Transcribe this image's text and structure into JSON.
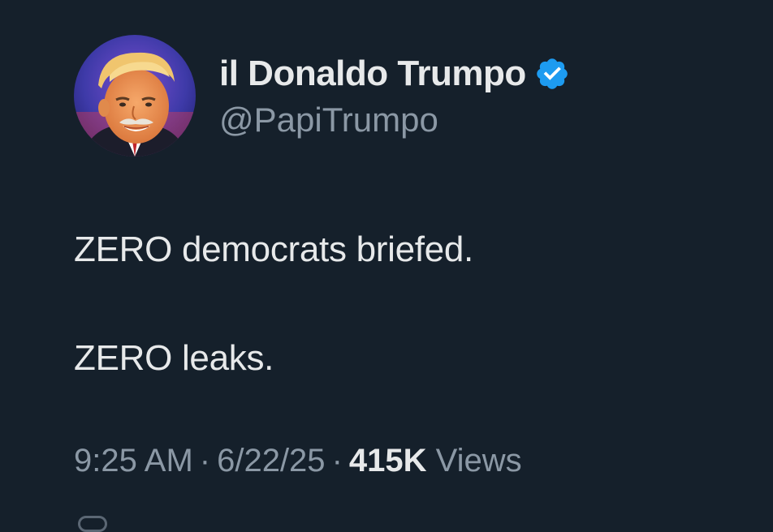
{
  "tweet": {
    "author": {
      "display_name": "il Donaldo Trumpo",
      "handle": "@PapiTrumpo",
      "verified": true,
      "avatar_icon": "profile-photo",
      "verified_icon": "verified-badge-icon"
    },
    "text_lines": [
      "ZERO democrats briefed.",
      "ZERO leaks."
    ],
    "time": "9:25 AM",
    "date": "6/22/25",
    "views_count": "415K",
    "views_label": "Views",
    "separator": "·"
  },
  "colors": {
    "background": "#15202b",
    "primary_text": "#e7e9ea",
    "secondary_text": "#8b98a5",
    "verified_blue": "#1d9bf0"
  }
}
